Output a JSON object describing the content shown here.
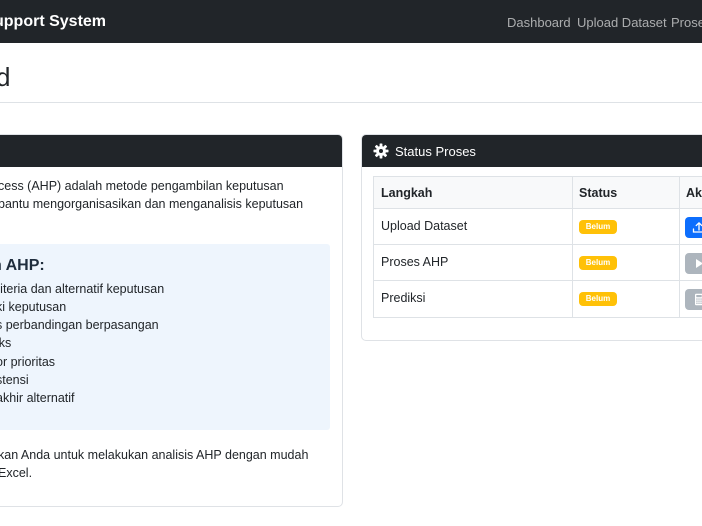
{
  "navbar": {
    "brand": "upport System",
    "links": [
      "Dashboard",
      "Upload Dataset",
      "Prose"
    ]
  },
  "page": {
    "title": "d"
  },
  "left_card": {
    "intro_lines": [
      "cess (AHP) adalah metode pengambilan keputusan",
      "bantu mengorganisasikan dan menganalisis keputusan"
    ],
    "info_title": "n AHP:",
    "steps": [
      "riteria dan alternatif keputusan",
      "ki keputusan",
      "s perbandingan berpasangan",
      "iks",
      "or prioritas",
      "stensi",
      "akhir alternatif"
    ],
    "footer_lines": [
      "kan Anda untuk melakukan analisis AHP dengan mudah",
      "Excel."
    ]
  },
  "status_card": {
    "title": "Status Proses",
    "headers": {
      "step": "Langkah",
      "status": "Status",
      "action": "Aks"
    },
    "rows": [
      {
        "step": "Upload Dataset",
        "status": "Belum",
        "action_icon": "upload-icon",
        "action_color": "#0d6efd"
      },
      {
        "step": "Proses AHP",
        "status": "Belum",
        "action_icon": "play-icon",
        "action_color": "#adb5bd"
      },
      {
        "step": "Prediksi",
        "status": "Belum",
        "action_icon": "calculator-icon",
        "action_color": "#adb5bd"
      }
    ]
  },
  "colors": {
    "navbar": "#212529",
    "badge_warning": "#ffc107",
    "primary": "#0d6efd",
    "disabled": "#adb5bd",
    "info_bg": "#eef5fd"
  }
}
